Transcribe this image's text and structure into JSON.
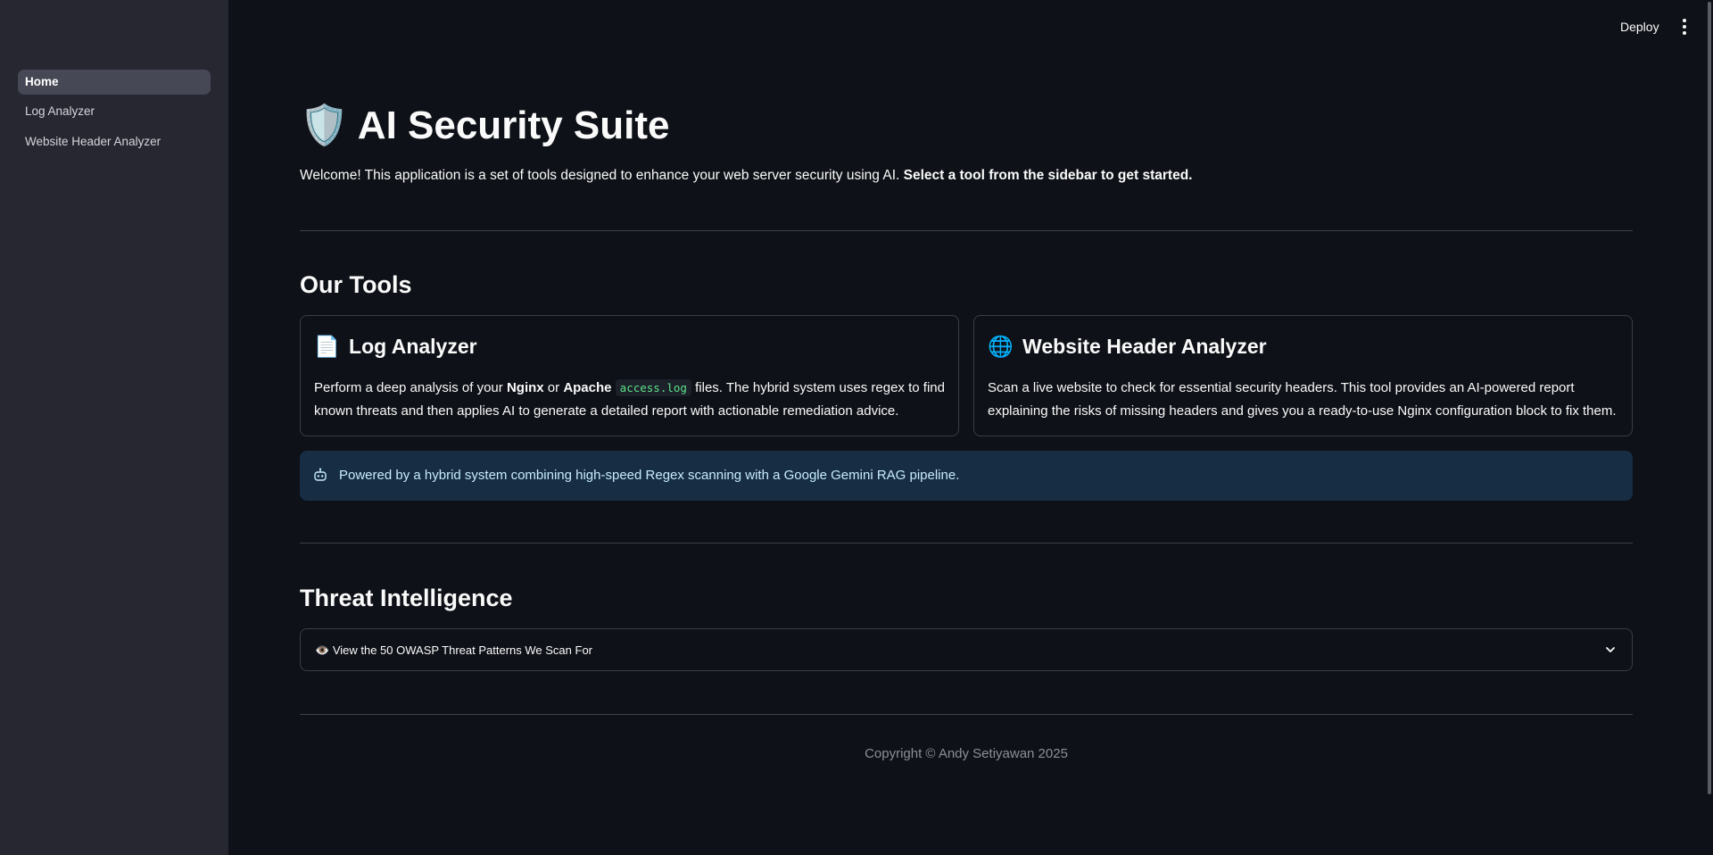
{
  "sidebar": {
    "items": [
      {
        "label": "Home",
        "active": true
      },
      {
        "label": "Log Analyzer",
        "active": false
      },
      {
        "label": "Website Header Analyzer",
        "active": false
      }
    ]
  },
  "topbar": {
    "deploy_label": "Deploy",
    "menu_icon": "kebab-menu-icon"
  },
  "header": {
    "title_emoji": "🛡️",
    "title": "AI Security Suite",
    "welcome_text": "Welcome! This application is a set of tools designed to enhance your web server security using AI.",
    "welcome_bold": "Select a tool from the sidebar to get started."
  },
  "tools": {
    "heading": "Our Tools",
    "log_analyzer": {
      "emoji": "📄",
      "title": "Log Analyzer",
      "text_1": "Perform a deep analysis of your",
      "bold_1": "Nginx",
      "text_2": "or",
      "bold_2": "Apache",
      "code": "access.log",
      "text_3": "files. The hybrid system uses regex to find known threats and then applies AI to generate a detailed report with actionable remediation advice."
    },
    "header_analyzer": {
      "emoji": "🌐",
      "title": "Website Header Analyzer",
      "description": "Scan a live website to check for essential security headers. This tool provides an AI-powered report explaining the risks of missing headers and gives you a ready-to-use Nginx configuration block to fix them."
    },
    "info_icon": "robot-icon",
    "info_text": "Powered by a hybrid system combining high-speed Regex scanning with a Google Gemini RAG pipeline."
  },
  "threat": {
    "heading": "Threat Intelligence",
    "expander_emoji": "👁️",
    "expander_label": "View the 50 OWASP Threat Patterns We Scan For"
  },
  "footer": {
    "copyright": "Copyright © Andy Setiyawan 2025"
  },
  "colors": {
    "background": "#0e1117",
    "sidebar": "#262730",
    "info_bg": "#172d43",
    "code_green": "#5ce488"
  }
}
